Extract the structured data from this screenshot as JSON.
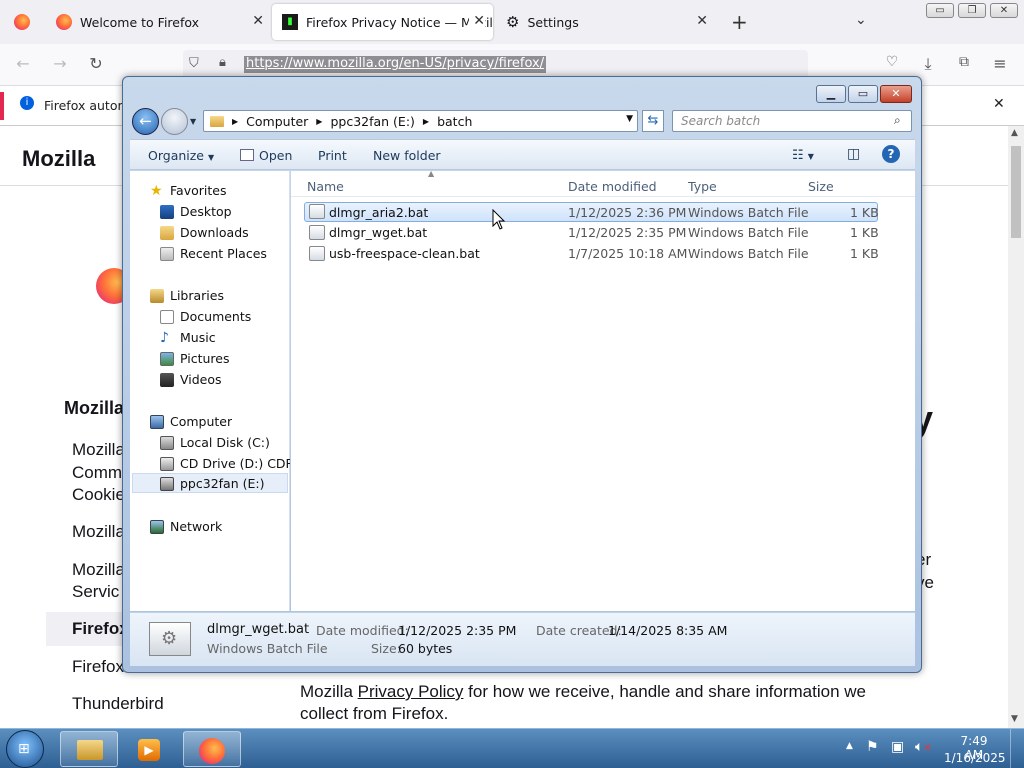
{
  "browser": {
    "tabs": [
      {
        "label": "Welcome to Firefox"
      },
      {
        "label": "Firefox Privacy Notice — Mozill"
      },
      {
        "label": "Settings"
      }
    ],
    "url": "https://www.mozilla.org/en-US/privacy/firefox/",
    "notification": "Firefox automa",
    "new_tab": "+"
  },
  "page": {
    "brand": "Mozilla",
    "left_heading": "Mozilla",
    "nav": [
      "Mozilla",
      "Comm",
      "Cookie",
      "Mozilla",
      "Mozilla",
      "Servic",
      "Firefox",
      "Firefox",
      "Thunderbird"
    ],
    "right_fragments": [
      "y",
      "er",
      "ve"
    ],
    "paragraph_line1_prefix": "Mozilla ",
    "paragraph_link": "Privacy Policy",
    "paragraph_line1_suffix": " for how we receive, handle and share information we",
    "paragraph_line2": "collect from Firefox."
  },
  "explorer": {
    "breadcrumb": [
      "Computer",
      "ppc32fan (E:)",
      "batch"
    ],
    "search_placeholder": "Search batch",
    "toolbar": {
      "organize": "Organize",
      "open": "Open",
      "print": "Print",
      "new_folder": "New folder"
    },
    "nav": {
      "favorites": "Favorites",
      "desktop": "Desktop",
      "downloads": "Downloads",
      "recent": "Recent Places",
      "libraries": "Libraries",
      "documents": "Documents",
      "music": "Music",
      "pictures": "Pictures",
      "videos": "Videos",
      "computer": "Computer",
      "local_disk": "Local Disk (C:)",
      "cd_drive": "CD Drive (D:) CDROM",
      "ppc32fan": "ppc32fan (E:)",
      "network": "Network"
    },
    "columns": {
      "name": "Name",
      "date": "Date modified",
      "type": "Type",
      "size": "Size"
    },
    "files": [
      {
        "name": "dlmgr_aria2.bat",
        "date": "1/12/2025 2:36 PM",
        "type": "Windows Batch File",
        "size": "1 KB"
      },
      {
        "name": "dlmgr_wget.bat",
        "date": "1/12/2025 2:35 PM",
        "type": "Windows Batch File",
        "size": "1 KB"
      },
      {
        "name": "usb-freespace-clean.bat",
        "date": "1/7/2025 10:18 AM",
        "type": "Windows Batch File",
        "size": "1 KB"
      }
    ],
    "details": {
      "name": "dlmgr_wget.bat",
      "type": "Windows Batch File",
      "modified_label": "Date modified:",
      "modified": "1/12/2025 2:35 PM",
      "created_label": "Date created:",
      "created": "1/14/2025 8:35 AM",
      "size_label": "Size:",
      "size": "60 bytes"
    }
  },
  "taskbar": {
    "time": "7:49 AM",
    "date": "1/16/2025"
  },
  "colors": {
    "selection": "#cfe3fb",
    "taskbar": "#2e5f93",
    "window_frame": "#aac2e0"
  }
}
